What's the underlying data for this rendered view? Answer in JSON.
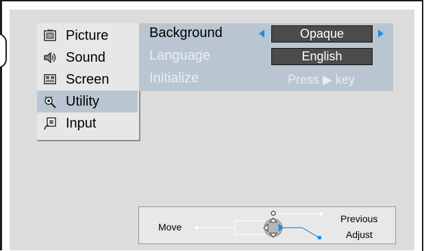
{
  "menu": {
    "items": [
      {
        "label": "Picture",
        "icon": "picture-icon"
      },
      {
        "label": "Sound",
        "icon": "sound-icon"
      },
      {
        "label": "Screen",
        "icon": "screen-icon"
      },
      {
        "label": "Utility",
        "icon": "utility-icon",
        "active": true
      },
      {
        "label": "Input",
        "icon": "input-icon"
      }
    ]
  },
  "submenu": {
    "background": {
      "label": "Background",
      "value": "Opaque"
    },
    "language": {
      "label": "Language",
      "value": "English"
    },
    "initialize": {
      "label": "Initialize",
      "value": "Press ▶ key"
    }
  },
  "help": {
    "move": "Move",
    "previous": "Previous",
    "adjust": "Adjust"
  },
  "colors": {
    "highlight": "#b9c6d2",
    "accent": "#1e8fe0",
    "value_box": "#4b4b4b"
  }
}
